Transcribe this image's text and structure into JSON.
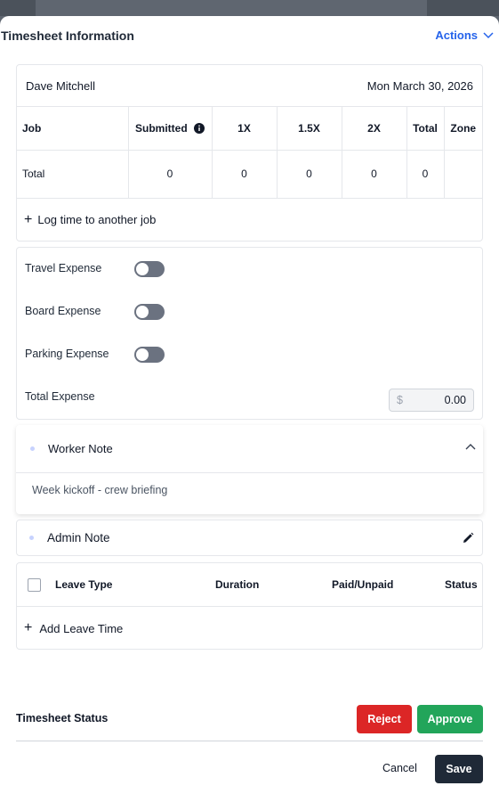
{
  "header": {
    "title": "Timesheet Information",
    "actions_label": "Actions"
  },
  "job": {
    "employee": "Dave Mitchell",
    "date": "Mon March 30, 2026",
    "columns": [
      "Job",
      "Submitted",
      "1X",
      "1.5X",
      "2X",
      "Total",
      "Zone"
    ],
    "total_row": {
      "label": "Total",
      "submitted": "0",
      "x1": "0",
      "x15": "0",
      "x2": "0",
      "total": "0",
      "zone": ""
    },
    "log_time_label": "Log time to another job"
  },
  "expenses": {
    "travel_label": "Travel Expense",
    "travel_on": false,
    "board_label": "Board Expense",
    "board_on": false,
    "parking_label": "Parking Expense",
    "parking_on": false,
    "total_label": "Total Expense",
    "currency": "$",
    "total_value": "0.00"
  },
  "worker_note": {
    "title": "Worker Note",
    "body": "Week kickoff - crew briefing"
  },
  "admin_note": {
    "title": "Admin Note"
  },
  "leave": {
    "columns": [
      "Leave Type",
      "Duration",
      "Paid/Unpaid",
      "Status"
    ],
    "add_label": "Add Leave Time"
  },
  "footer": {
    "status_label": "Timesheet Status",
    "reject_label": "Reject",
    "approve_label": "Approve",
    "cancel_label": "Cancel",
    "save_label": "Save"
  },
  "colors": {
    "accent": "#2563eb",
    "reject": "#dc2626",
    "approve": "#22a55a",
    "save": "#1f2937"
  }
}
